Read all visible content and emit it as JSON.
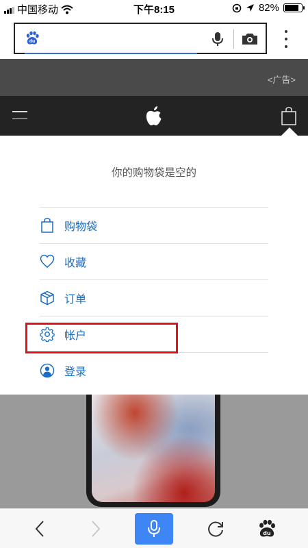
{
  "status_bar": {
    "carrier": "中国移动",
    "time": "下午8:15",
    "battery": "82%",
    "battery_level": 0.82
  },
  "browser": {
    "url_text": "",
    "icons": [
      "baidu-paw-icon",
      "microphone-icon",
      "camera-icon",
      "more-vertical-icon"
    ]
  },
  "ad": {
    "label": "<广告>"
  },
  "nav": {
    "icons": [
      "hamburger-icon",
      "apple-logo-icon",
      "shopping-bag-icon"
    ]
  },
  "bag_panel": {
    "empty_message": "你的购物袋是空的",
    "items": [
      {
        "label": "购物袋",
        "icon": "bag-icon"
      },
      {
        "label": "收藏",
        "icon": "heart-icon"
      },
      {
        "label": "订单",
        "icon": "box-icon"
      },
      {
        "label": "帐户",
        "icon": "gear-icon"
      },
      {
        "label": "登录",
        "icon": "user-icon"
      }
    ]
  },
  "toolbar": {
    "icons": [
      "back-icon",
      "forward-icon",
      "microphone-icon",
      "refresh-icon",
      "baidu-paw-icon"
    ]
  },
  "colors": {
    "accent": "#1a6dc4",
    "highlight_box": "#e0111b",
    "mic_button": "#3e86f5",
    "nav_bg": "#232323",
    "ad_bg": "#4a4a4a"
  }
}
